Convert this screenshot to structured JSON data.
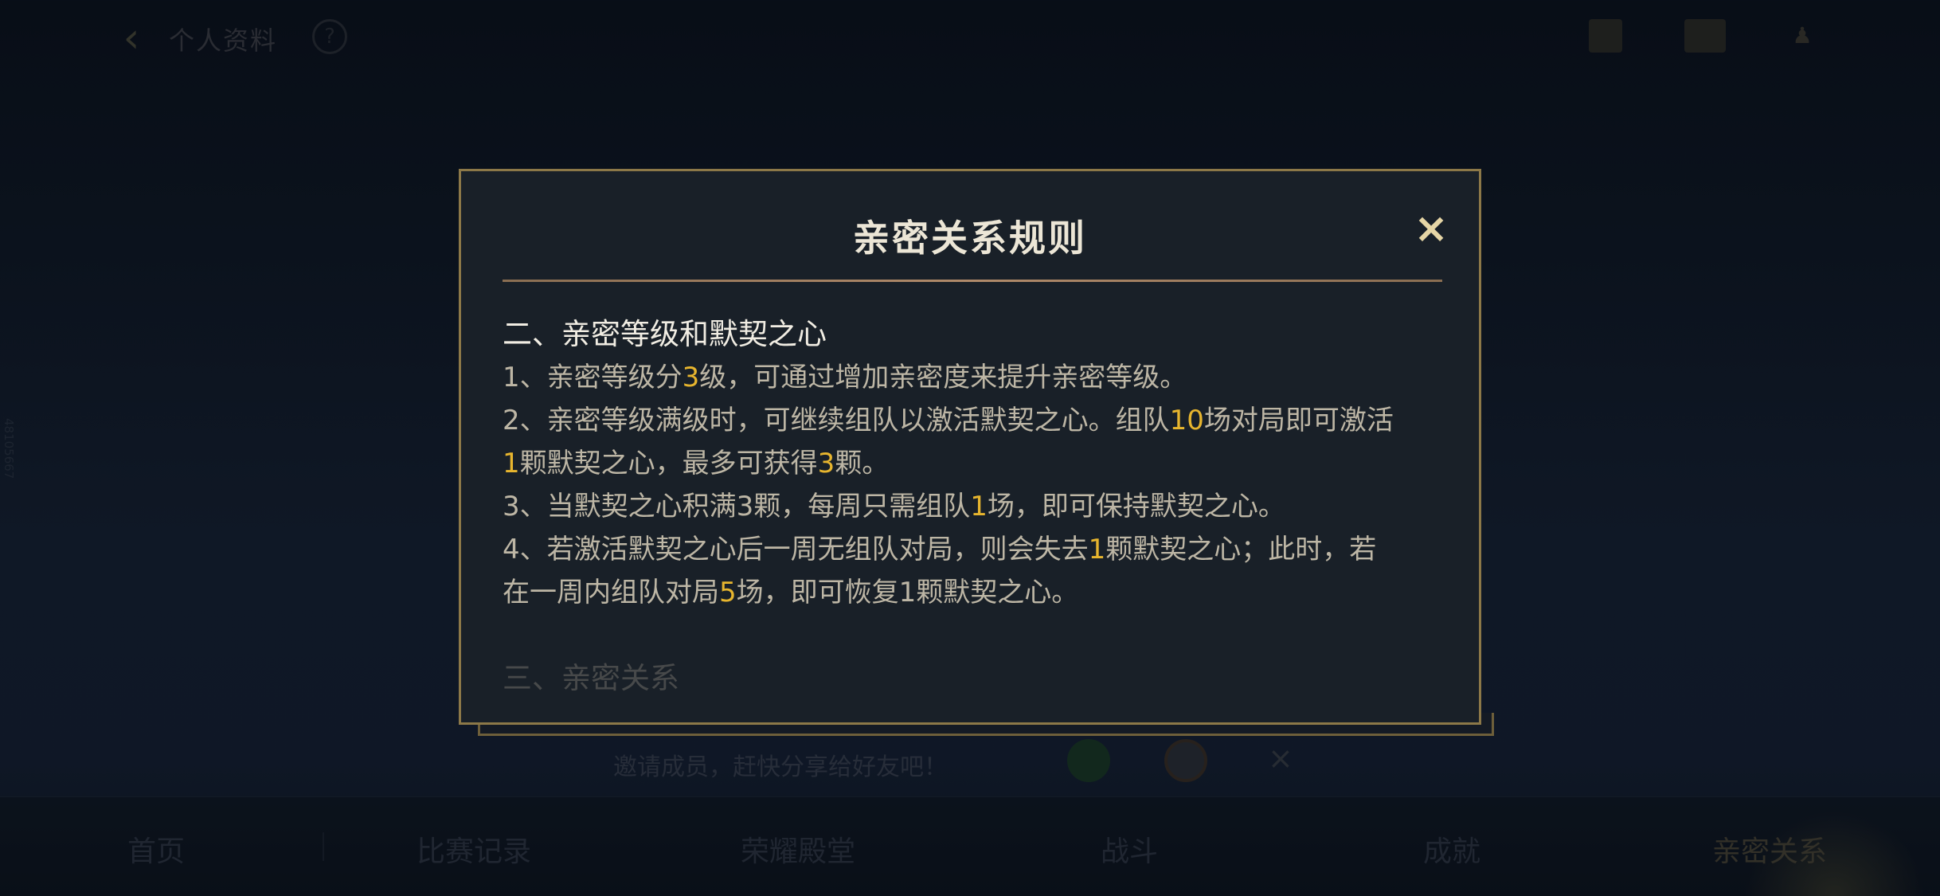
{
  "background": {
    "page_title": "个人资料",
    "help_icon": "?",
    "side_id": "48105667",
    "share": {
      "text": "邀请成员，赶快分享给好友吧！",
      "close": "×"
    },
    "nav_items": [
      "首页",
      "比赛记录",
      "荣耀殿堂",
      "战斗",
      "成就",
      "亲密关系"
    ]
  },
  "modal": {
    "title": "亲密关系规则",
    "close": "×",
    "section2_heading": "二、亲密等级和默契之心",
    "rules": [
      [
        "1、亲密等级分",
        "3",
        "级，可通过增加亲密度来提升亲密等级。"
      ],
      [
        "2、亲密等级满级时，可继续组队以激活默契之心。组队",
        "10",
        "场对局即可激活"
      ],
      [
        "",
        "1",
        "颗默契之心，最多可获得",
        "3",
        "颗。"
      ],
      [
        "3、当默契之心积满3颗，每周只需组队",
        "1",
        "场，即可保持默契之心。"
      ],
      [
        "4、若激活默契之心后一周无组队对局，则会失去",
        "1",
        "颗默契之心；此时，若"
      ],
      [
        "在一周内组队对局",
        "5",
        "场，即可恢复1颗默契之心。"
      ]
    ],
    "section3_heading": "三、亲密关系"
  },
  "colors": {
    "highlight": "#e7b52e",
    "border_gold": "#8c7848",
    "modal_bg": "#192028"
  }
}
